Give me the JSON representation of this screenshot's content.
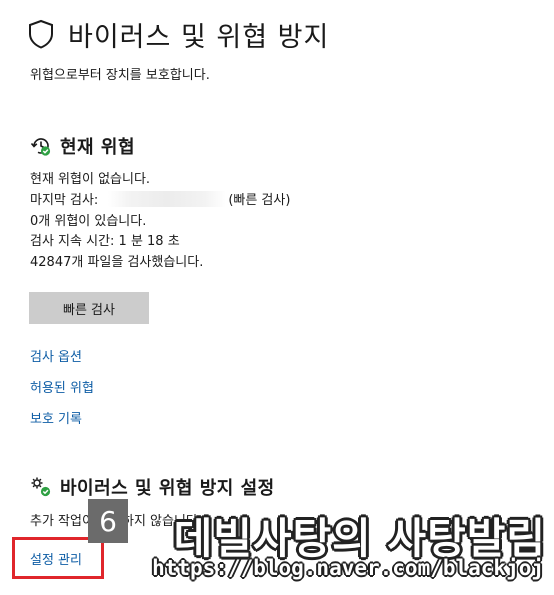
{
  "header": {
    "title": "바이러스 및 위협 방지",
    "subtitle": "위협으로부터 장치를 보호합니다."
  },
  "current_threats": {
    "title": "현재 위협",
    "lines": {
      "no_threats": "현재 위협이 없습니다.",
      "last_scan_prefix": "마지막 검사:",
      "last_scan_suffix": "(빠른 검사)",
      "threats_found": "0개 위협이 있습니다.",
      "scan_duration": "검사 지속 시간: 1 분 18 초",
      "files_scanned": "42847개 파일을 검사했습니다."
    },
    "quick_scan_label": "빠른 검사",
    "links": {
      "scan_options": "검사 옵션",
      "allowed_threats": "허용된 위협",
      "protection_history": "보호 기록"
    }
  },
  "settings": {
    "title": "바이러스 및 위협 방지 설정",
    "description": "추가 작업이 필요하지 않습니다.",
    "manage_label": "설정 관리"
  },
  "annotation": {
    "step": "6",
    "highlight_color": "#e0262b"
  },
  "watermark": {
    "name": "데빌사탕의 사탕발림",
    "url": "https://blog.naver.com/blackjoj"
  },
  "colors": {
    "link": "#0f5ea6",
    "button_bg": "#cccccc",
    "ok_badge": "#2ea043"
  }
}
